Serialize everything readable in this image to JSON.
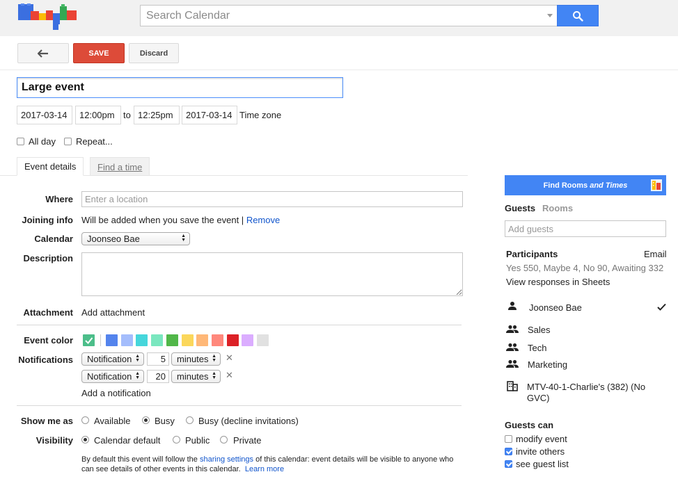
{
  "colors": {
    "accent": "#4285f4",
    "save": "#dd4b39",
    "link": "#1155cc"
  },
  "search": {
    "placeholder": "Search Calendar"
  },
  "toolbar": {
    "back_icon": "back-arrow-icon",
    "save_label": "SAVE",
    "discard_label": "Discard"
  },
  "event": {
    "title": "Large event",
    "start_date": "2017-03-14",
    "start_time": "12:00pm",
    "to_label": "to",
    "end_time": "12:25pm",
    "end_date": "2017-03-14",
    "timezone_label": "Time zone",
    "all_day_label": "All day",
    "repeat_label": "Repeat..."
  },
  "tabs": [
    {
      "label": "Event details",
      "active": true
    },
    {
      "label": "Find a time",
      "active": false
    }
  ],
  "details": {
    "where_label": "Where",
    "where_placeholder": "Enter a location",
    "joining_label": "Joining info",
    "joining_text": "Will be added when you save the event |",
    "joining_remove": "Remove",
    "calendar_label": "Calendar",
    "calendar_value": "Joonseo Bae",
    "description_label": "Description",
    "attachment_label": "Attachment",
    "attachment_link": "Add attachment",
    "event_color_label": "Event color",
    "event_colors": [
      "#5484ed",
      "#a4bdfc",
      "#46d6db",
      "#7ae7bf",
      "#51b749",
      "#fbd75b",
      "#ffb878",
      "#ff887c",
      "#dc2127",
      "#dbadff",
      "#e1e1e1"
    ],
    "notifications_label": "Notifications",
    "notifications": [
      {
        "type": "Notification",
        "value": "5",
        "unit": "minutes"
      },
      {
        "type": "Notification",
        "value": "20",
        "unit": "minutes"
      }
    ],
    "add_notification": "Add a notification",
    "show_me_as_label": "Show me as",
    "show_me_as_options": [
      "Available",
      "Busy",
      "Busy (decline invitations)"
    ],
    "show_me_as_selected": 1,
    "visibility_label": "Visibility",
    "visibility_options": [
      "Calendar default",
      "Public",
      "Private"
    ],
    "visibility_selected": 0,
    "sharing_prefix": "By default this event will follow the ",
    "sharing_link": "sharing settings",
    "sharing_middle": " of this calendar: event details will be visible to anyone who",
    "sharing_line2": "can see details of other events in this calendar.",
    "learn_more": "Learn more"
  },
  "side": {
    "find_rooms_prefix": "Find Rooms ",
    "find_rooms_italic": "and Times",
    "tab_guests": "Guests",
    "tab_rooms": "Rooms",
    "add_guests_placeholder": "Add guests",
    "participants_label": "Participants",
    "email_label": "Email",
    "rsvp_summary": "Yes 550, Maybe 4, No 90, Awaiting 332",
    "view_responses": "View responses in Sheets",
    "guests": [
      {
        "name": "Joonseo Bae",
        "icon": "person-icon",
        "checked": true
      },
      {
        "name": "Sales",
        "icon": "group-icon",
        "checked": false
      },
      {
        "name": "Tech",
        "icon": "group-icon",
        "checked": false
      },
      {
        "name": "Marketing",
        "icon": "group-icon",
        "checked": false
      }
    ],
    "room_line1": "MTV-40-1-Charlie's (382) (No",
    "room_line2": "GVC)",
    "guests_can_label": "Guests can",
    "permissions": [
      {
        "label": "modify event",
        "checked": false
      },
      {
        "label": "invite others",
        "checked": true
      },
      {
        "label": "see guest list",
        "checked": true
      }
    ]
  }
}
